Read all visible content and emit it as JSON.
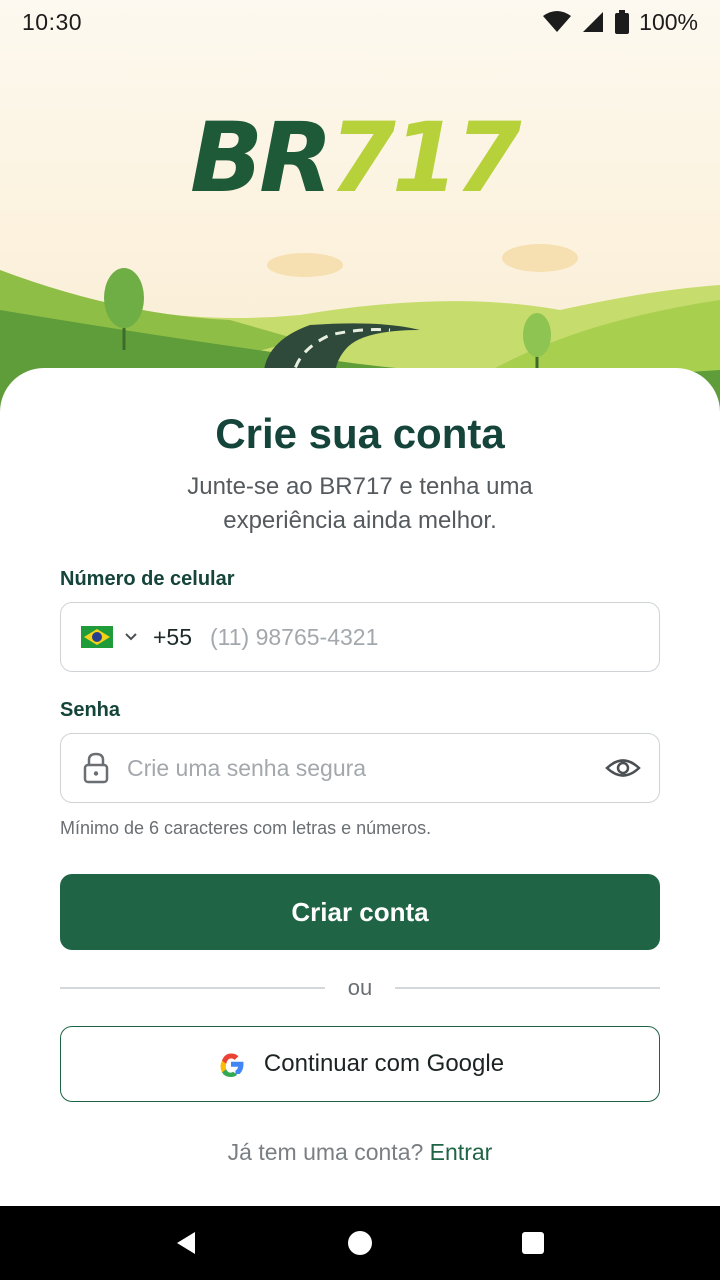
{
  "status_bar": {
    "time": "10:30",
    "battery": "100%",
    "icons": [
      "wifi-icon",
      "signal-icon",
      "battery-icon"
    ]
  },
  "logo": {
    "part1": "BR",
    "part2": "717"
  },
  "colors": {
    "brand_dark": "#1f6444",
    "brand_lime": "#b6d13a",
    "title": "#15443a"
  },
  "form": {
    "title": "Crie sua conta",
    "subtitle": "Junte-se ao BR717 e tenha uma experiência ainda melhor.",
    "phone": {
      "label": "Número de celular",
      "country_icon": "brazil-flag-icon",
      "dial_code": "+55",
      "placeholder": "(11) 98765-4321",
      "value": ""
    },
    "password": {
      "label": "Senha",
      "placeholder": "Crie uma senha segura",
      "value": "",
      "hint": "Mínimo de 6 caracteres com letras e números."
    },
    "submit_label": "Criar conta",
    "divider_text": "ou",
    "google_label": "Continuar com Google",
    "signin_prompt": "Já tem uma conta?",
    "signin_link": "Entrar"
  },
  "nav_bar": {
    "buttons": [
      "back-icon",
      "home-icon",
      "recents-icon"
    ]
  }
}
